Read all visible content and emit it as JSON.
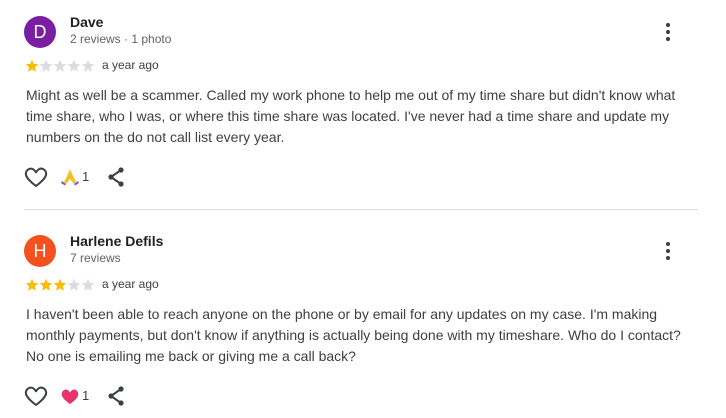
{
  "colors": {
    "avatar_dave": "#7b1fa2",
    "avatar_harlene": "#f4511e",
    "star_filled": "#fbbc04",
    "star_empty": "#dadce0"
  },
  "reviews": [
    {
      "initial": "D",
      "name": "Dave",
      "meta": "2 reviews · 1 photo",
      "rating": 1,
      "max_rating": 5,
      "time": "a year ago",
      "text": "Might as well be a scammer. Called my work phone to help me out of my time share but didn't know what time share, who I was, or where this time share was located. I've never had a time share and update my numbers on the do not call list every year.",
      "reaction_icon": "praying-hands-icon",
      "reaction_count": "1"
    },
    {
      "initial": "H",
      "name": "Harlene Defils",
      "meta": "7 reviews",
      "rating": 3,
      "max_rating": 5,
      "time": "a year ago",
      "text": "I haven't been able to reach anyone on the phone or by email for any updates on my case. I'm making monthly payments, but don't know if anything is actually being done with my timeshare. Who do I contact? No one is emailing me back or giving me a call back?",
      "reaction_icon": "heart-icon",
      "reaction_count": "1"
    }
  ]
}
